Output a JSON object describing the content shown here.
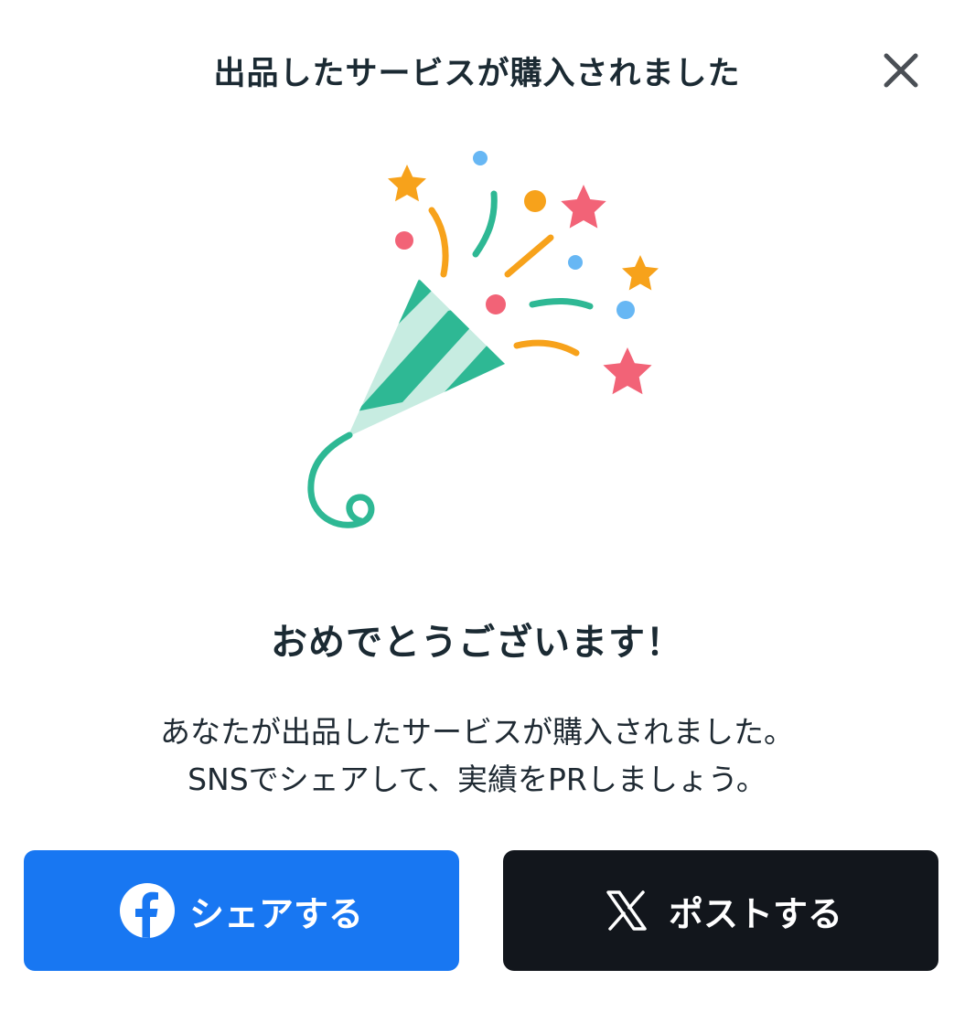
{
  "dialog": {
    "title": "出品したサービスが購入されました",
    "close_icon": "close-icon"
  },
  "content": {
    "illustration": "party-popper-icon",
    "headline": "おめでとうございます！",
    "message_line1": "あなたが出品したサービスが購入されました。",
    "message_line2": "SNSでシェアして、実績をPRしましょう。"
  },
  "buttons": {
    "facebook": {
      "label": "シェアする",
      "icon": "facebook-icon",
      "color": "#1877f2"
    },
    "x": {
      "label": "ポストする",
      "icon": "x-logo-icon",
      "color": "#12161c"
    }
  },
  "colors": {
    "teal": "#2eb894",
    "teal_light": "#c7ece1",
    "orange": "#f7a21b",
    "pink": "#f26377",
    "blue": "#67b7f4"
  }
}
